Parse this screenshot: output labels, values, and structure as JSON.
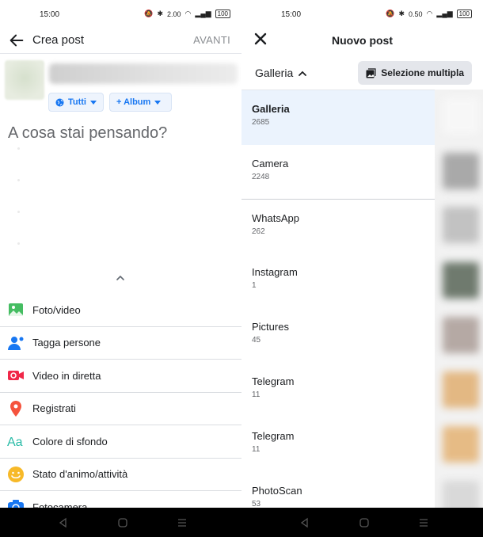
{
  "left": {
    "status": {
      "time": "15:00",
      "speed": "2.00",
      "battery": "100"
    },
    "header": {
      "title": "Crea post",
      "next_label": "AVANTI"
    },
    "chips": [
      {
        "label": "Tutti"
      },
      {
        "label": "+ Album"
      }
    ],
    "composer_placeholder": "A cosa stai pensando?",
    "actions": [
      {
        "label": "Foto/video",
        "icon": "photo-icon",
        "color": "#45bd62"
      },
      {
        "label": "Tagga persone",
        "icon": "tag-people-icon",
        "color": "#1877f2"
      },
      {
        "label": "Video in diretta",
        "icon": "live-video-icon",
        "color": "#f02849"
      },
      {
        "label": "Registrati",
        "icon": "location-pin-icon",
        "color": "#f5533d"
      },
      {
        "label": "Colore di sfondo",
        "icon": "text-background-icon",
        "color": "#2abba7"
      },
      {
        "label": "Stato d'animo/attività",
        "icon": "smiley-icon",
        "color": "#f7b928"
      },
      {
        "label": "Fotocamera",
        "icon": "camera-icon",
        "color": "#1877f2"
      }
    ]
  },
  "right": {
    "status": {
      "time": "15:00",
      "speed": "0.50",
      "battery": "100"
    },
    "header": {
      "title": "Nuovo post"
    },
    "gallery_selector": "Galleria",
    "multi_select_label": "Selezione multipla",
    "albums": [
      {
        "name": "Galleria",
        "count": "2685"
      },
      {
        "name": "Camera",
        "count": "2248"
      },
      {
        "name": "WhatsApp",
        "count": "262"
      },
      {
        "name": "Instagram",
        "count": "1"
      },
      {
        "name": "Pictures",
        "count": "45"
      },
      {
        "name": "Telegram",
        "count": "11"
      },
      {
        "name": "Telegram",
        "count": "11"
      },
      {
        "name": "PhotoScan",
        "count": "53"
      }
    ]
  },
  "colors": {
    "accent": "#1877f2",
    "selected_row": "#ebf3fd",
    "nav_bar": "#000000"
  }
}
